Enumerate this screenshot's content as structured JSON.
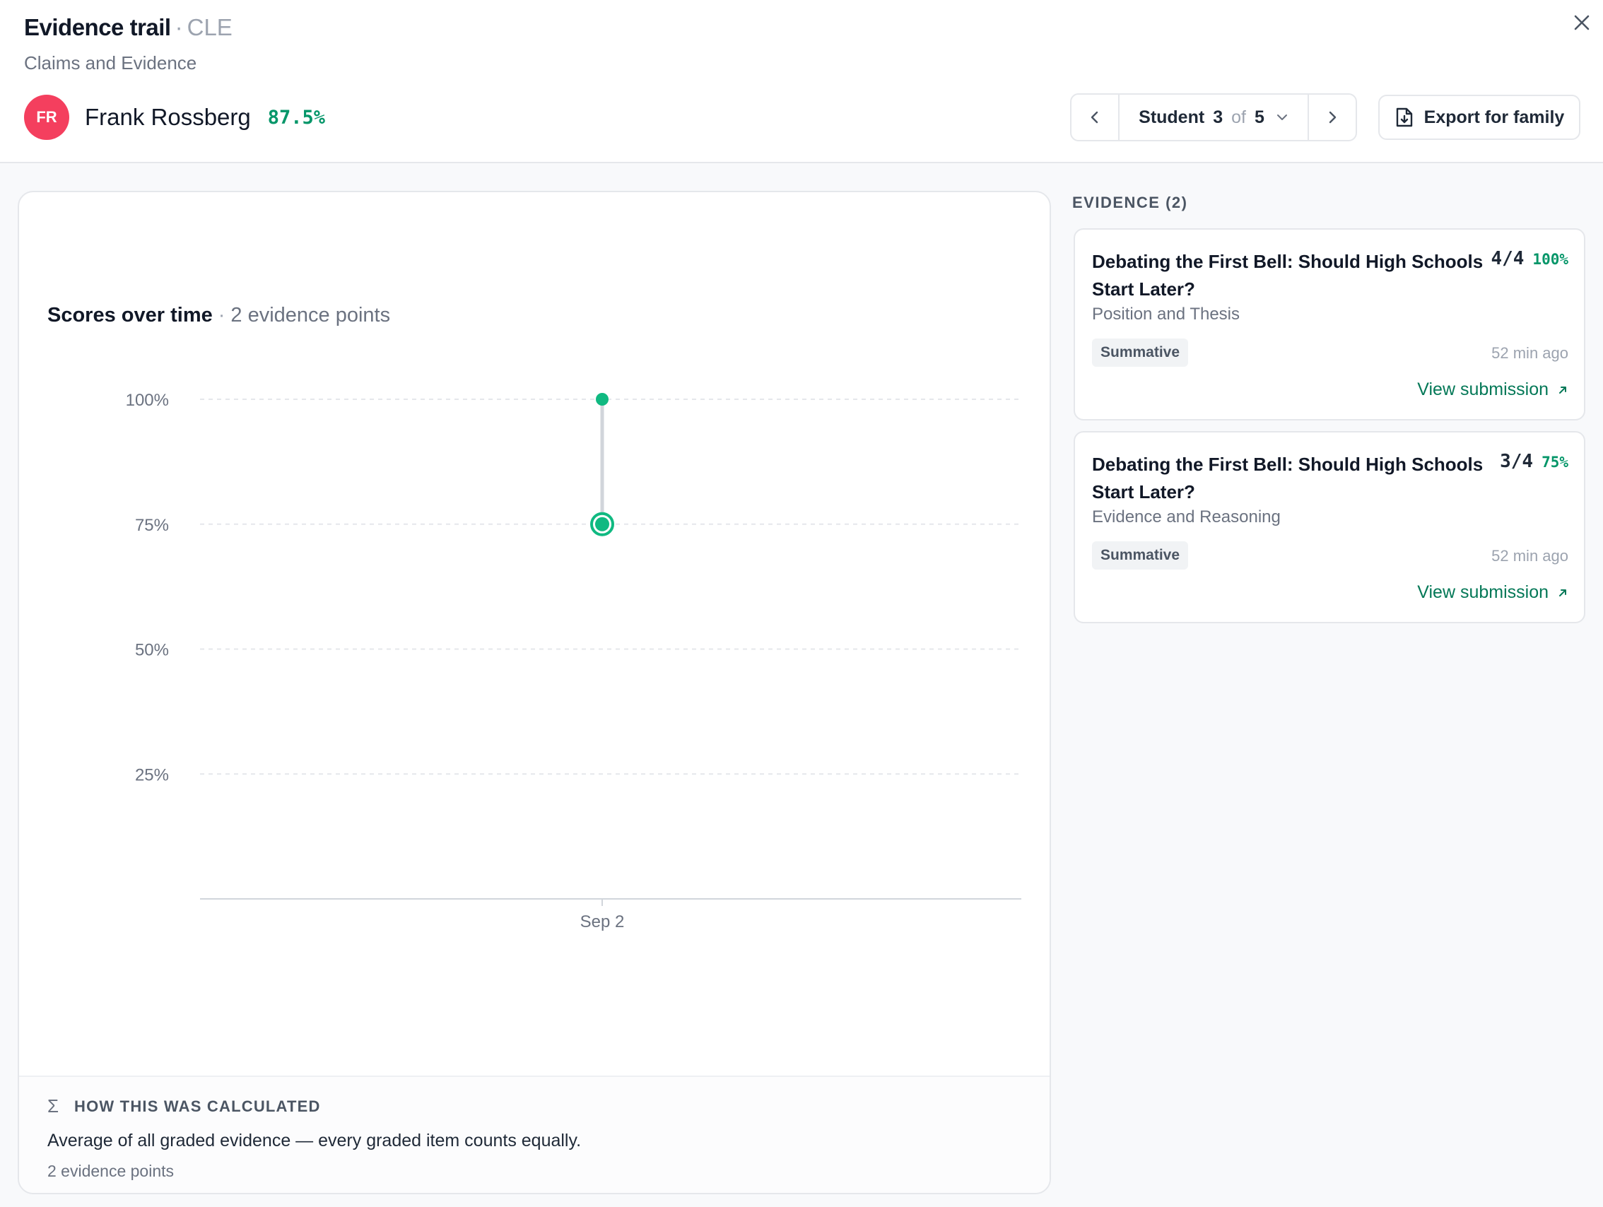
{
  "header": {
    "title": "Evidence trail",
    "title_separator": "·",
    "course_code": "CLE",
    "subtitle": "Claims and Evidence",
    "close_icon": "close-icon"
  },
  "student": {
    "initials": "FR",
    "name": "Frank Rossberg",
    "score": "87.5%",
    "avatar_color": "#f43f5e"
  },
  "stepper": {
    "label": "Student",
    "current": "3",
    "of": "of",
    "total": "5",
    "prev_icon": "chevron-left-icon",
    "next_icon": "chevron-right-icon",
    "dropdown_icon": "chevron-down-icon"
  },
  "export": {
    "label": "Export for family",
    "icon": "file-download-icon"
  },
  "chart": {
    "heading": "Scores over time",
    "separator": "·",
    "subheading": "2 evidence points"
  },
  "chart_data": {
    "type": "scatter",
    "x_categories": [
      "Sep 2"
    ],
    "y_ticks": [
      "100%",
      "75%",
      "50%",
      "25%"
    ],
    "y_tick_values": [
      100,
      75,
      50,
      25
    ],
    "ylim": [
      0,
      100
    ],
    "grid": true,
    "points": [
      {
        "x": "Sep 2",
        "y": 100,
        "style": "small"
      },
      {
        "x": "Sep 2",
        "y": 75,
        "style": "highlighted"
      }
    ],
    "range_line": {
      "x": "Sep 2",
      "from": 75,
      "to": 100
    },
    "accent_color": "#10b981"
  },
  "calculation": {
    "icon": "sigma-icon",
    "heading": "HOW THIS WAS CALCULATED",
    "description": "Average of all graded evidence — every graded item counts equally.",
    "count": "2 evidence points"
  },
  "evidence": {
    "title": "EVIDENCE (2)",
    "items": [
      {
        "title": "Debating the First Bell: Should High Schools Start Later?",
        "points": "4/4",
        "percent": "100%",
        "criterion": "Position and Thesis",
        "badge": "Summative",
        "time": "52 min ago",
        "link": "View submission"
      },
      {
        "title": "Debating the First Bell: Should High Schools Start Later?",
        "points": "3/4",
        "percent": "75%",
        "criterion": "Evidence and Reasoning",
        "badge": "Summative",
        "time": "52 min ago",
        "link": "View submission"
      }
    ]
  }
}
